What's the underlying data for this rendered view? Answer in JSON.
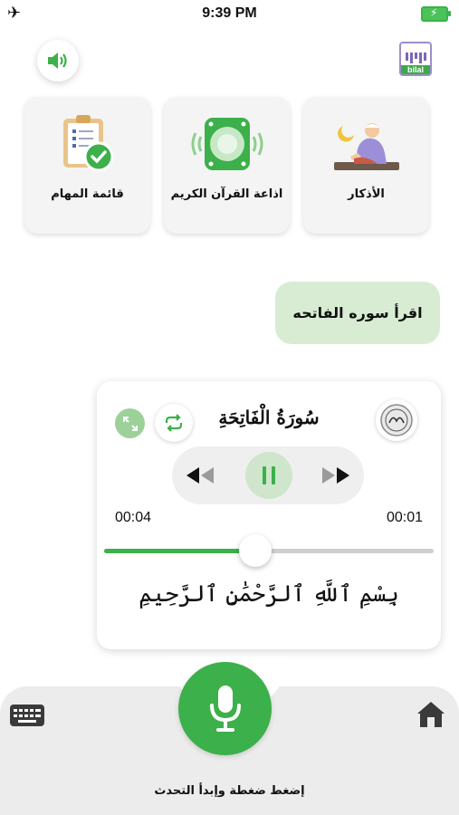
{
  "status_bar": {
    "time": "9:39 PM"
  },
  "cards": [
    {
      "label": "قائمة المهام",
      "icon": "clipboard-check-icon"
    },
    {
      "label": "اذاعة القرآن الكريم",
      "icon": "radio-speaker-icon"
    },
    {
      "label": "الأذكار",
      "icon": "praying-man-icon"
    }
  ],
  "chat": {
    "message": "اقرأ سوره الفاتحه"
  },
  "player": {
    "title": "سُورَةُ الْفَاتِحَةِ",
    "time_elapsed": "00:04",
    "time_remaining": "00:01",
    "progress": 0.46,
    "verse": "بِسْمِ ٱللَّهِ ٱلرَّحْمَٰنِ ٱلرَّحِيمِ"
  },
  "bottom": {
    "hint": "إضغط ضغطة وإبدأ التحدث"
  },
  "colors": {
    "accent": "#3cb04a",
    "bubble": "#d8ecd3",
    "card_bg": "#f4f4f4"
  }
}
